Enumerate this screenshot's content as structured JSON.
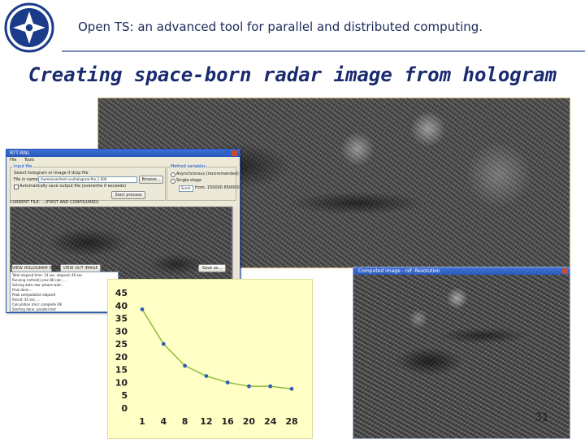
{
  "header": {
    "title": "Open TS: an advanced tool for parallel and distributed computing.",
    "logo_icon": "institute-emblem-icon",
    "logo_color": "#1a3a8a"
  },
  "slide": {
    "title": "Creating space-born radar image from hologram",
    "page_number": "31"
  },
  "app_window": {
    "title": "RTT-RNL",
    "menu": [
      "File",
      "Tools"
    ],
    "input_group": {
      "label": "Input file",
      "select_text": "Select hologram or image if drop file",
      "file_label": "File is named:",
      "file_value": "/home/user/test-run/hologram-file_1.000",
      "browse": "Browse...",
      "auto_save": "Automatically save output file (overwrite if exceeds)",
      "start": "Start process"
    },
    "method_group": {
      "label": "Method variables",
      "option1": "Asynchronous (recommended)",
      "option2": "Single-stage",
      "scroll_label": "Scroll",
      "scroll_value": "from: 150000 650000"
    },
    "image_caption": "CURRENT FILE: ...(FIRST AND CONFIGURED)",
    "view_btn": "VIEW HOLOGRAM WINDOW",
    "view_img_btn": "VIEW OUT IMAGE",
    "save_btn": "Save as...",
    "log_lines": [
      "Total elapsed time: 14 sec, elapsed: 40 sec",
      "Running (refresh) proc 86  calc, ...",
      "Solving data now: please wait...",
      "Final done...",
      "Peak computation elapsed",
      "Result: 45 sec, ...",
      "Calculation (ms): complete OK",
      "Starting done: parallel test"
    ],
    "accent_color": "#2656b8"
  },
  "result_window": {
    "title": "Computed image - ref. Resolution"
  },
  "chart_data": {
    "type": "line",
    "x": [
      "1",
      "4",
      "8",
      "12",
      "16",
      "20",
      "24",
      "28"
    ],
    "values": [
      38.5,
      25,
      16.5,
      12.5,
      10,
      8.5,
      8.5,
      7.5
    ],
    "yticks": [
      "0",
      "5",
      "10",
      "15",
      "20",
      "25",
      "30",
      "35",
      "40",
      "45"
    ],
    "ylim": [
      0,
      45
    ],
    "grid": false,
    "background": "#ffffc6",
    "line_color": "#8bbf3a",
    "marker_color": "#2e5fb8"
  }
}
